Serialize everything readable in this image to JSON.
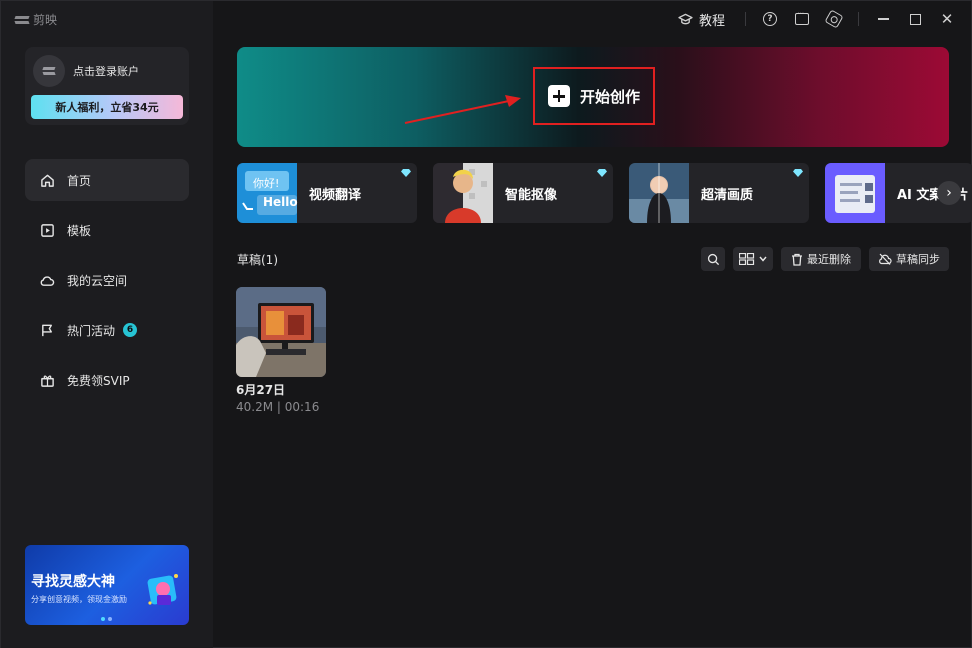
{
  "app": {
    "name": "剪映"
  },
  "titlebar": {
    "tutorial_label": "教程",
    "icons": [
      "help-icon",
      "feedback-icon",
      "settings-icon"
    ],
    "window_controls": [
      "minimize",
      "maximize",
      "close"
    ]
  },
  "account": {
    "login_label": "点击登录账户",
    "promo_label": "新人福利，立省34元"
  },
  "nav": {
    "items": [
      {
        "label": "首页",
        "icon": "home-icon",
        "active": true
      },
      {
        "label": "模板",
        "icon": "template-icon"
      },
      {
        "label": "我的云空间",
        "icon": "cloud-icon"
      },
      {
        "label": "热门活动",
        "icon": "flag-icon",
        "badge": "6"
      },
      {
        "label": "免费领SVIP",
        "icon": "gift-icon"
      }
    ]
  },
  "inspire": {
    "title": "寻找灵感大神",
    "subtitle": "分享创意视频，领现金激励"
  },
  "hero": {
    "label": "开始创作"
  },
  "features": [
    {
      "label": "视频翻译",
      "thumb_text_top": "你好!",
      "thumb_text_bottom": "Hello"
    },
    {
      "label": "智能抠像"
    },
    {
      "label": "超清画质"
    },
    {
      "label": "AI 文案成片"
    }
  ],
  "drafts": {
    "title": "草稿(1)",
    "toolbar": {
      "recent_delete": "最近删除",
      "sync": "草稿同步"
    },
    "items": [
      {
        "name": "6月27日",
        "meta": "40.2M | 00:16"
      }
    ]
  },
  "colors": {
    "accent": "#27c4d4",
    "highlight_border": "#e02020",
    "background": "#161618",
    "sidebar": "#1c1c1f"
  }
}
